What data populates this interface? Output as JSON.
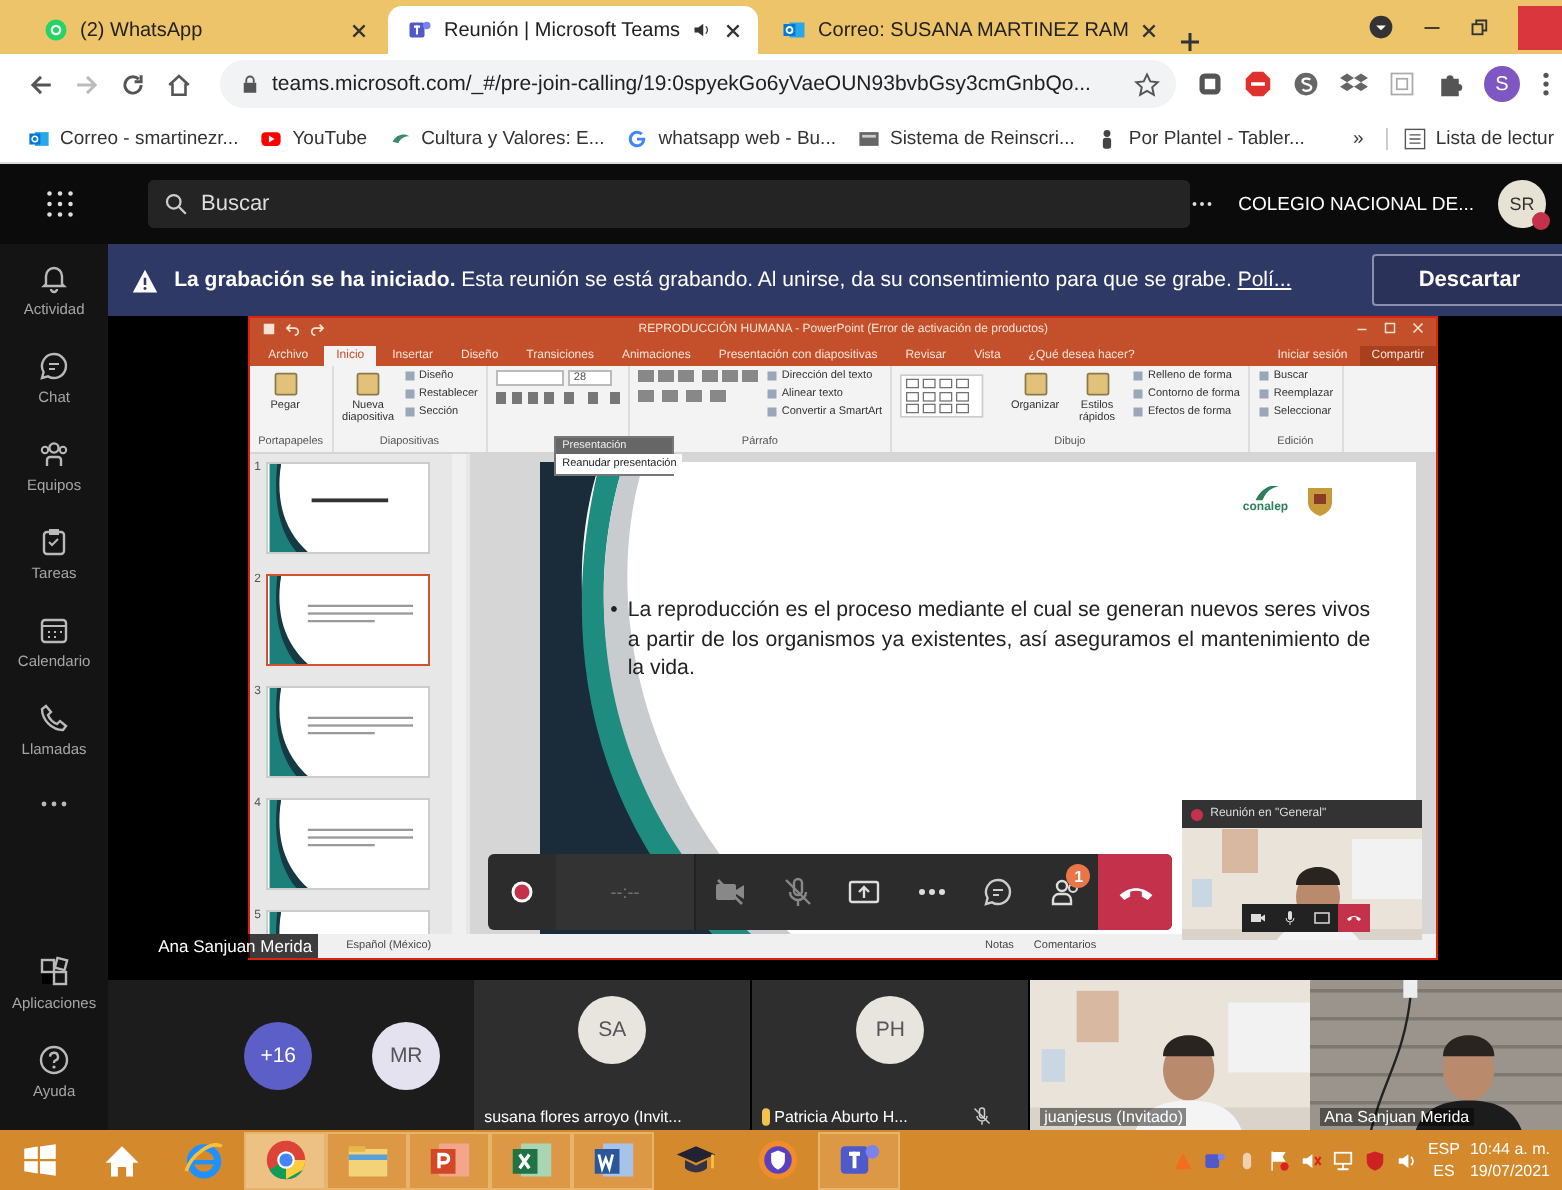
{
  "browser": {
    "tabs": [
      {
        "title": "(2) WhatsApp",
        "kind": "whatsapp",
        "selected": false
      },
      {
        "title": "Reunión | Microsoft Teams",
        "kind": "teams",
        "selected": true,
        "audio": true
      },
      {
        "title": "Correo: SUSANA MARTINEZ RAM",
        "kind": "outlook",
        "selected": false
      }
    ],
    "address": "teams.microsoft.com/_#/pre-join-calling/19:0spyekGo6yVaeOUN93bvbGsy3cmGnbQo...",
    "profile": "S",
    "bookmarks": [
      {
        "label": "Correo - smartinezr...",
        "kind": "outlook"
      },
      {
        "label": "YouTube",
        "kind": "youtube"
      },
      {
        "label": "Cultura y Valores: E...",
        "kind": "leaf"
      },
      {
        "label": "whatsapp web - Bu...",
        "kind": "google"
      },
      {
        "label": "Sistema de Reinscri...",
        "kind": "page"
      },
      {
        "label": "Por Plantel - Tabler...",
        "kind": "person"
      }
    ],
    "bookmarks_more": "»",
    "reading_list": "Lista de lectur"
  },
  "teams": {
    "search_placeholder": "Buscar",
    "org": "COLEGIO NACIONAL DE...",
    "avatar": "SR",
    "rail": [
      {
        "label": "Actividad",
        "kind": "bell"
      },
      {
        "label": "Chat",
        "kind": "chat"
      },
      {
        "label": "Equipos",
        "kind": "teams"
      },
      {
        "label": "Tareas",
        "kind": "tasks"
      },
      {
        "label": "Calendario",
        "kind": "calendar"
      },
      {
        "label": "Llamadas",
        "kind": "phone"
      },
      {
        "kind": "more"
      }
    ],
    "rail_bottom": [
      {
        "label": "Aplicaciones",
        "kind": "apps"
      },
      {
        "label": "Ayuda",
        "kind": "help"
      }
    ],
    "banner": {
      "message": "**La grabación se ha iniciado.** Esta reunión se está grabando. Al unirse, da su consentimiento para que se grabe.",
      "link": "Polí...",
      "button": "Descartar"
    }
  },
  "powerpoint": {
    "title": "REPRODUCCIÓN HUMANA - PowerPoint (Error de activación de productos)",
    "tabs": [
      {
        "label": "Archivo",
        "selected": false
      },
      {
        "label": "Inicio",
        "selected": true
      },
      {
        "label": "Insertar",
        "selected": false
      },
      {
        "label": "Diseño",
        "selected": false
      },
      {
        "label": "Transiciones",
        "selected": false
      },
      {
        "label": "Animaciones",
        "selected": false
      },
      {
        "label": "Presentación con diapositivas",
        "selected": false
      },
      {
        "label": "Revisar",
        "selected": false
      },
      {
        "label": "Vista",
        "selected": false
      }
    ],
    "tell_me": "¿Qué desea hacer?",
    "sign_in": "Iniciar sesión",
    "share": "Compartir",
    "groups": [
      {
        "label": "Portapapeles",
        "items": [
          {
            "kind": "large",
            "label": "Pegar"
          }
        ]
      },
      {
        "label": "Diapositivas",
        "items": [
          {
            "kind": "large",
            "label": "Nueva diapositiva"
          },
          {
            "kind": "small",
            "label": "Diseño"
          },
          {
            "kind": "small",
            "label": "Restablecer"
          },
          {
            "kind": "small",
            "label": "Sección"
          }
        ]
      },
      {
        "items": [
          {
            "kind": "font",
            "label": "28"
          }
        ]
      },
      {
        "label": "Párrafo",
        "items": [
          {
            "kind": "paragraph"
          },
          {
            "kind": "small",
            "label": "Dirección del texto"
          },
          {
            "kind": "small",
            "label": "Alinear texto"
          },
          {
            "kind": "small",
            "label": "Convertir a SmartArt"
          }
        ]
      },
      {
        "label": "Dibujo",
        "items": [
          {
            "kind": "shapes"
          },
          {
            "kind": "large",
            "label": "Organizar"
          },
          {
            "kind": "large",
            "label": "Estilos rápidos"
          },
          {
            "kind": "small",
            "label": "Relleno de forma"
          },
          {
            "kind": "small",
            "label": "Contorno de forma"
          },
          {
            "kind": "small",
            "label": "Efectos de forma"
          }
        ]
      },
      {
        "label": "Edición",
        "items": [
          {
            "kind": "small",
            "label": "Buscar"
          },
          {
            "kind": "small",
            "label": "Reemplazar"
          },
          {
            "kind": "small",
            "label": "Seleccionar"
          }
        ]
      }
    ],
    "popup": {
      "title": "Presentación",
      "item": "Reanudar presentación"
    },
    "thumbnails": [
      {
        "number": "1",
        "selected": false
      },
      {
        "number": "2",
        "selected": true
      },
      {
        "number": "3",
        "selected": false
      },
      {
        "number": "4",
        "selected": false
      },
      {
        "number": "5",
        "selected": false
      }
    ],
    "slide": {
      "logo": "conalep",
      "marker": "•",
      "bullet": "La reproducción es el proceso mediante el cual se generan nuevos seres vivos a partir de los organismos ya existentes, así aseguramos el mantenimiento de la vida."
    },
    "status": {
      "language": "Español (México)",
      "notes": "Notas",
      "comments": "Comentarios"
    }
  },
  "call": {
    "participants_badge": "1",
    "timer": "--:--",
    "mini_title": "Reunión en \"General\"",
    "speaker": "Ana Sanjuan Merida"
  },
  "participants": [
    {
      "kind": "overflow",
      "label": "+16"
    },
    {
      "kind": "avatar",
      "label": "MR"
    },
    {
      "kind": "tile",
      "label": "SA",
      "name": "susana flores arroyo (Invit..."
    },
    {
      "kind": "tile",
      "label": "PH",
      "name": "Patricia Aburto H...",
      "muted": true,
      "hand": true
    },
    {
      "kind": "video",
      "name": "juanjesus (Invitado)"
    },
    {
      "kind": "video",
      "name": "Ana Sanjuan Merida"
    }
  ],
  "taskbar": {
    "apps": [
      {
        "kind": "home",
        "running": false,
        "selected": false
      },
      {
        "kind": "ie",
        "running": false,
        "selected": false
      },
      {
        "kind": "chrome",
        "running": true,
        "selected": true
      },
      {
        "kind": "folder",
        "running": true,
        "selected": false
      },
      {
        "kind": "powerpoint",
        "running": true,
        "selected": false
      },
      {
        "kind": "excel",
        "running": true,
        "selected": false
      },
      {
        "kind": "word",
        "running": true,
        "selected": false
      },
      {
        "kind": "cap",
        "running": false,
        "selected": false
      },
      {
        "kind": "vpn",
        "running": false,
        "selected": false
      },
      {
        "kind": "teams",
        "running": true,
        "selected": false
      }
    ],
    "lang": "ESP",
    "layout": "ES",
    "time": "10:44 a. m.",
    "date": "19/07/2021"
  }
}
